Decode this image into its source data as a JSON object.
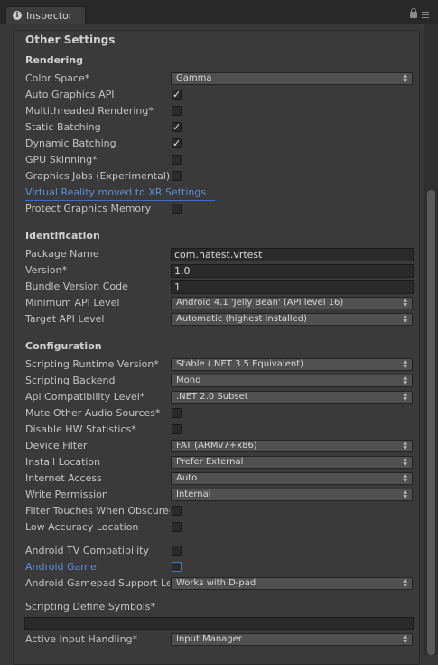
{
  "window": {
    "tab_label": "Inspector",
    "tab_icon": "info-icon"
  },
  "other_settings": {
    "title": "Other Settings",
    "rendering": {
      "title": "Rendering",
      "color_space": {
        "label": "Color Space*",
        "value": "Gamma"
      },
      "auto_graphics_api": {
        "label": "Auto Graphics API",
        "checked": true
      },
      "multithreaded_rendering": {
        "label": "Multithreaded Rendering*",
        "checked": false
      },
      "static_batching": {
        "label": "Static Batching",
        "checked": true
      },
      "dynamic_batching": {
        "label": "Dynamic Batching",
        "checked": true
      },
      "gpu_skinning": {
        "label": "GPU Skinning*",
        "checked": false
      },
      "graphics_jobs": {
        "label": "Graphics Jobs (Experimental)*",
        "checked": false
      },
      "vr_link": "Virtual Reality moved to XR Settings",
      "protect_graphics_memory": {
        "label": "Protect Graphics Memory",
        "checked": false
      }
    },
    "identification": {
      "title": "Identification",
      "package_name": {
        "label": "Package Name",
        "value": "com.hatest.vrtest"
      },
      "version": {
        "label": "Version*",
        "value": "1.0"
      },
      "bundle_version_code": {
        "label": "Bundle Version Code",
        "value": "1"
      },
      "min_api_level": {
        "label": "Minimum API Level",
        "value": "Android 4.1 'Jelly Bean' (API level 16)"
      },
      "target_api_level": {
        "label": "Target API Level",
        "value": "Automatic (highest installed)"
      }
    },
    "configuration": {
      "title": "Configuration",
      "scripting_runtime_version": {
        "label": "Scripting Runtime Version*",
        "value": "Stable (.NET 3.5 Equivalent)"
      },
      "scripting_backend": {
        "label": "Scripting Backend",
        "value": "Mono"
      },
      "api_compatibility_level": {
        "label": "Api Compatibility Level*",
        "value": ".NET 2.0 Subset"
      },
      "mute_other_audio": {
        "label": "Mute Other Audio Sources*",
        "checked": false
      },
      "disable_hw_statistics": {
        "label": "Disable HW Statistics*",
        "checked": false
      },
      "device_filter": {
        "label": "Device Filter",
        "value": "FAT (ARMv7+x86)"
      },
      "install_location": {
        "label": "Install Location",
        "value": "Prefer External"
      },
      "internet_access": {
        "label": "Internet Access",
        "value": "Auto"
      },
      "write_permission": {
        "label": "Write Permission",
        "value": "Internal"
      },
      "filter_touches": {
        "label": "Filter Touches When Obscured",
        "checked": false
      },
      "low_accuracy_location": {
        "label": "Low Accuracy Location",
        "checked": false
      },
      "android_tv_compat": {
        "label": "Android TV Compatibility",
        "checked": false
      },
      "android_game": {
        "label": "Android Game",
        "checked": false
      },
      "gamepad_support": {
        "label": "Android Gamepad Support Level",
        "value": "Works with D-pad"
      },
      "scripting_define_symbols": {
        "label": "Scripting Define Symbols*",
        "value": ""
      },
      "active_input_handling": {
        "label": "Active Input Handling*",
        "value": "Input Manager"
      }
    }
  },
  "colors": {
    "link": "#5a8fd9",
    "background": "#383838",
    "focus": "#4a7ec6"
  }
}
